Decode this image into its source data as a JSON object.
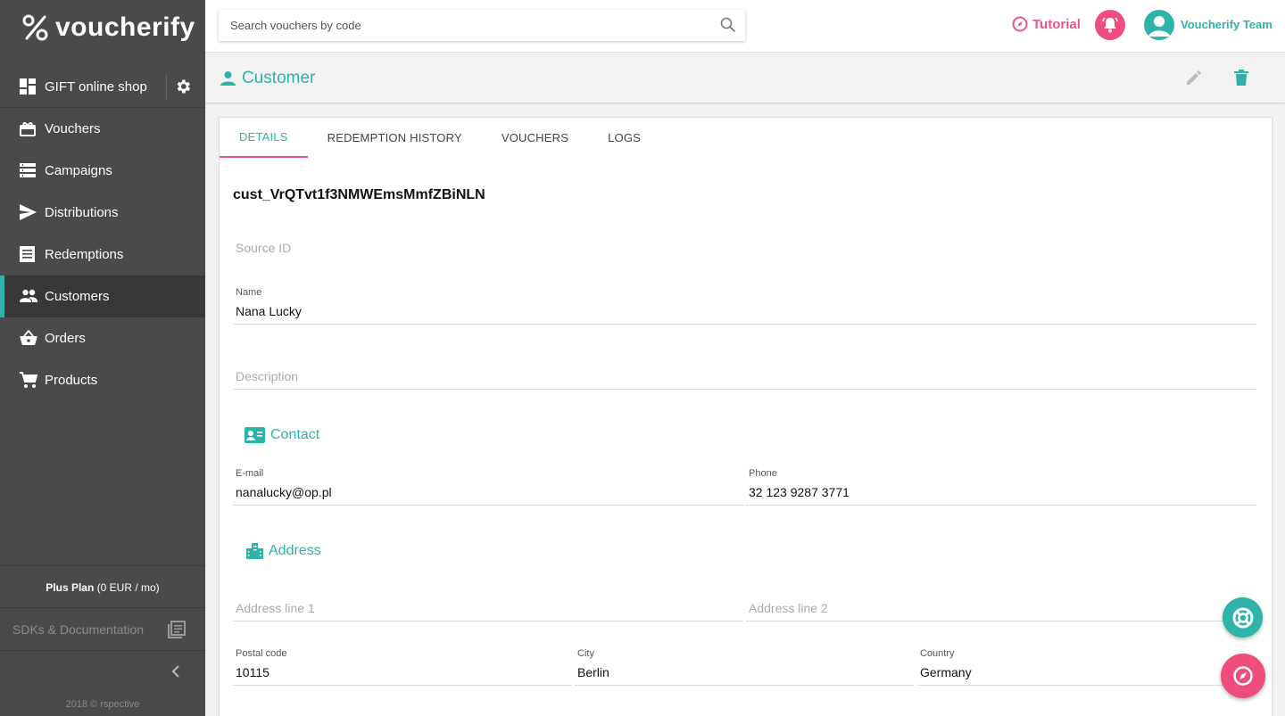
{
  "brand": {
    "name": "voucherify",
    "accent": "#2db3a7",
    "pink": "#ef4d7b"
  },
  "sidebar": {
    "shop": {
      "label": "GIFT online shop",
      "icon": "dashboard-icon"
    },
    "items": [
      {
        "label": "Vouchers",
        "icon": "gift-icon"
      },
      {
        "label": "Campaigns",
        "icon": "list-icon"
      },
      {
        "label": "Distributions",
        "icon": "send-icon"
      },
      {
        "label": "Redemptions",
        "icon": "receipt-icon"
      },
      {
        "label": "Customers",
        "icon": "people-icon",
        "active": true
      },
      {
        "label": "Orders",
        "icon": "basket-icon"
      },
      {
        "label": "Products",
        "icon": "cart-icon"
      }
    ],
    "plan": {
      "name": "Plus Plan",
      "price": "(0 EUR / mo)"
    },
    "sdk_label": "SDKs & Documentation",
    "copyright": "2018 © rspective"
  },
  "topbar": {
    "search_placeholder": "Search vouchers by code",
    "tutorial": "Tutorial",
    "team": "Voucherify Team"
  },
  "page": {
    "title": "Customer"
  },
  "tabs": [
    "DETAILS",
    "REDEMPTION HISTORY",
    "VOUCHERS",
    "LOGS"
  ],
  "customer": {
    "id": "cust_VrQTvt1f3NMWEmsMmfZBiNLN",
    "source_id_placeholder": "Source ID",
    "name_label": "Name",
    "name": "Nana Lucky",
    "description_placeholder": "Description",
    "contact_title": "Contact",
    "email_label": "E-mail",
    "email": "nanalucky@op.pl",
    "phone_label": "Phone",
    "phone": "32 123 9287 3771",
    "address_title": "Address",
    "address1_placeholder": "Address line 1",
    "address2_placeholder": "Address line 2",
    "postal_label": "Postal code",
    "postal": "10115",
    "city_label": "City",
    "city": "Berlin",
    "country_label": "Country",
    "country": "Germany"
  }
}
